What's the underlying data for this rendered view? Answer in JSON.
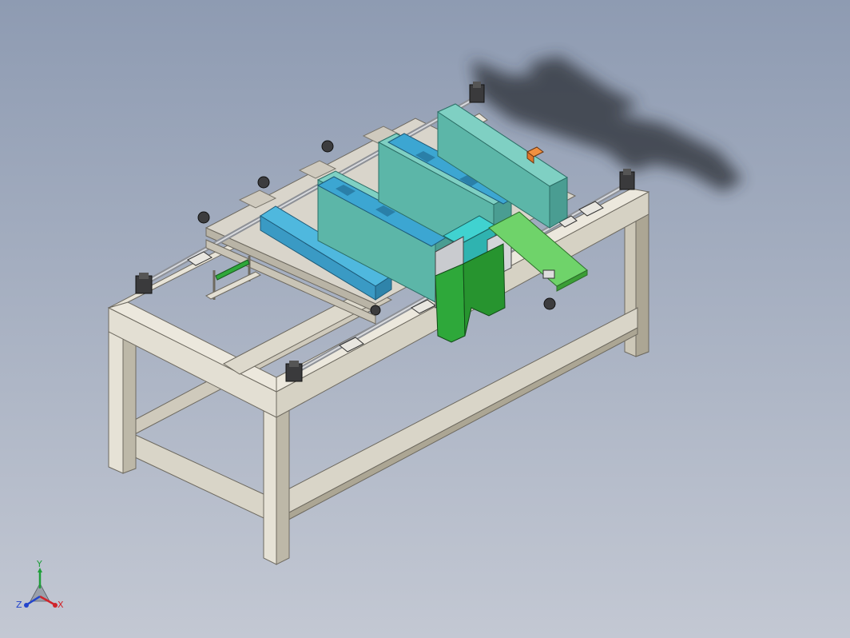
{
  "viewport": {
    "background_top": "#8e9bb2",
    "background_bottom": "#c3c8d3"
  },
  "colors": {
    "frame_light": "#e6e2d6",
    "frame_mid": "#cdc8b8",
    "frame_dark": "#aca694",
    "plate": "#d9d5cb",
    "teal_panel": "#5cb6a8",
    "blue_bar": "#3ca6d2",
    "green_part": "#2ea83a",
    "light_green": "#6fd36a",
    "orange_part": "#e0782a",
    "shadow": "#2c3038"
  },
  "triad": {
    "y_label": "Y",
    "x_label": "X",
    "z_label": "Z",
    "y_color": "#1f9e3a",
    "x_color": "#d0242a",
    "z_color": "#2244cc"
  }
}
